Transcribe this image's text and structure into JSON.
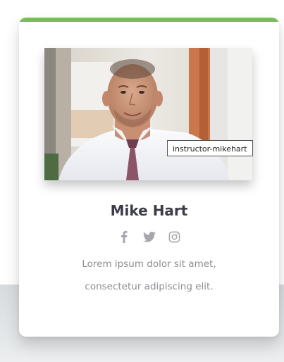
{
  "instructor": {
    "name": "Mike Hart",
    "photo_tooltip": "instructor-mikehart",
    "description_lines": [
      "Lorem ipsum dolor sit amet,",
      "consectetur adipiscing elit."
    ],
    "social_icons": [
      "facebook-icon",
      "twitter-icon",
      "instagram-icon"
    ]
  },
  "colors": {
    "accent": "#7cba5f",
    "name_text": "#3c3c48",
    "body_text": "#8e8e94",
    "icon": "#a7a7ad"
  }
}
